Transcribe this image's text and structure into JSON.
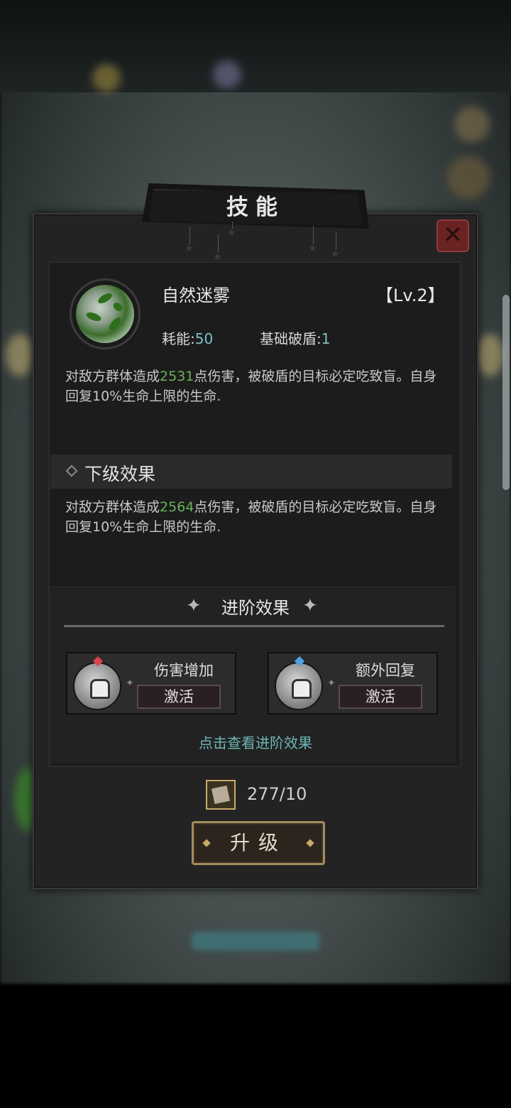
{
  "dialog": {
    "title": "技能",
    "close_icon": "close-icon"
  },
  "skill": {
    "name": "自然迷雾",
    "level": "【Lv.2】",
    "cost_label": "耗能:",
    "cost_value": "50",
    "shield_break_label": "基础破盾:",
    "shield_break_value": "1",
    "desc_prefix": "对敌方群体造成",
    "desc_damage": "2531",
    "desc_suffix": "点伤害，被破盾的目标必定吃致盲。自身回复10%生命上限的生命."
  },
  "next_level": {
    "header": "下级效果",
    "desc_prefix": "对敌方群体造成",
    "desc_damage": "2564",
    "desc_suffix": "点伤害，被破盾的目标必定吃致盲。自身回复10%生命上限的生命."
  },
  "advanced": {
    "title": "进阶效果",
    "cards": [
      {
        "name": "伤害增加",
        "button": "激活",
        "gem_color": "#d9434f"
      },
      {
        "name": "额外回复",
        "button": "激活",
        "gem_color": "#4aa3e0"
      }
    ],
    "view_link": "点击查看进阶效果"
  },
  "upgrade": {
    "cost": "277/10",
    "button": "升级"
  },
  "colors": {
    "highlight_green": "#6ab05a",
    "stat_teal": "#7fc0c4",
    "link_teal": "#6bb7b3",
    "gold_border": "#a38b5d"
  }
}
